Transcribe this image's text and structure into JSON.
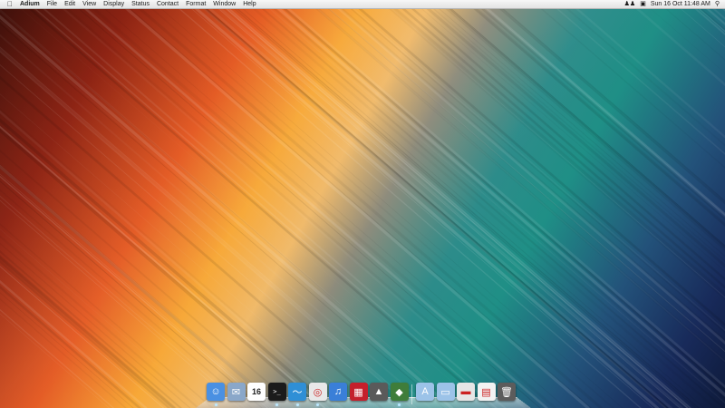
{
  "menubar": {
    "apple_icon": "apple-icon",
    "app_name": "Adium",
    "menus": [
      "File",
      "Edit",
      "View",
      "Display",
      "Status",
      "Contact",
      "Format",
      "Window",
      "Help"
    ],
    "status_icons": [
      "users-icon",
      "camera-icon"
    ],
    "clock": "Sun 16 Oct  11:48 AM",
    "search_icon": "spotlight-icon"
  },
  "dock": {
    "items": [
      {
        "name": "finder",
        "icon": "finder-icon",
        "glyph": "☺",
        "color": "#4a90e2",
        "running": true
      },
      {
        "name": "mail",
        "icon": "mail-icon",
        "glyph": "✉",
        "color": "#8aa7c9",
        "running": false
      },
      {
        "name": "calendar",
        "icon": "calendar-icon",
        "glyph": "16",
        "color": "#ffffff",
        "running": false
      },
      {
        "name": "terminal",
        "icon": "terminal-icon",
        "glyph": ">_",
        "color": "#1b1b1b",
        "running": true
      },
      {
        "name": "app-blue-wave",
        "icon": "blue-wave-icon",
        "glyph": "〜",
        "color": "#2f8fd6",
        "running": true
      },
      {
        "name": "chrome",
        "icon": "chrome-icon",
        "glyph": "◎",
        "color": "#e8e8e8",
        "running": true
      },
      {
        "name": "itunes",
        "icon": "itunes-icon",
        "glyph": "♫",
        "color": "#3a7fd8",
        "running": false
      },
      {
        "name": "photo-booth",
        "icon": "photo-booth-icon",
        "glyph": "▦",
        "color": "#c4202c",
        "running": false
      },
      {
        "name": "app-gray",
        "icon": "gray-app-icon",
        "glyph": "▲",
        "color": "#5a5a5a",
        "running": false
      },
      {
        "name": "adium",
        "icon": "adium-duck-icon",
        "glyph": "◆",
        "color": "#3f7d3a",
        "running": true
      },
      {
        "name": "applications-folder",
        "icon": "applications-folder-icon",
        "glyph": "A",
        "color": "#9cc3e8",
        "running": false
      },
      {
        "name": "documents-folder",
        "icon": "documents-folder-icon",
        "glyph": "▭",
        "color": "#9cc3e8",
        "running": false
      },
      {
        "name": "downloads-stack",
        "icon": "downloads-stack-icon",
        "glyph": "▬",
        "color": "#e6e6e6",
        "running": false
      },
      {
        "name": "document-stack",
        "icon": "document-stack-icon",
        "glyph": "▤",
        "color": "#f2f2f2",
        "running": false
      },
      {
        "name": "trash",
        "icon": "trash-icon",
        "glyph": "🗑",
        "color": "#5c5c5c",
        "running": false
      }
    ]
  }
}
